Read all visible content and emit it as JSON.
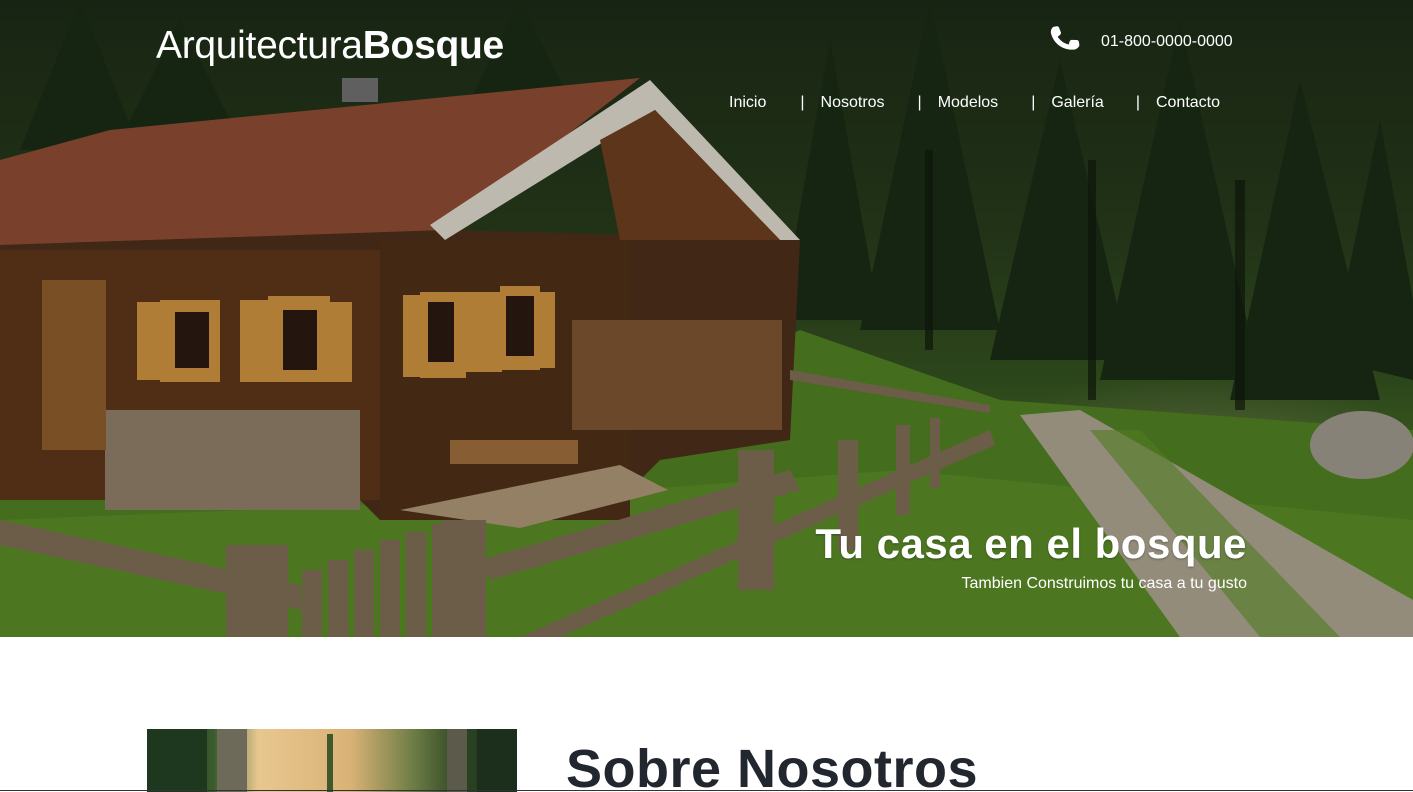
{
  "header": {
    "logo_light": "Arquitectura",
    "logo_bold": "Bosque",
    "phone_icon": "phone-icon",
    "phone_number": "01-800-0000-0000"
  },
  "nav": {
    "separator": "|",
    "items": [
      {
        "label": "Inicio"
      },
      {
        "label": "Nosotros"
      },
      {
        "label": "Modelos"
      },
      {
        "label": "Galería"
      },
      {
        "label": "Contacto"
      }
    ]
  },
  "hero": {
    "title": "Tu casa en el bosque",
    "subtitle": "Tambien Construimos tu casa a tu gusto"
  },
  "about": {
    "title": "Sobre Nosotros"
  },
  "colors": {
    "text_light": "#ffffff",
    "heading_dark": "#22262e",
    "forest": "#26391b"
  }
}
